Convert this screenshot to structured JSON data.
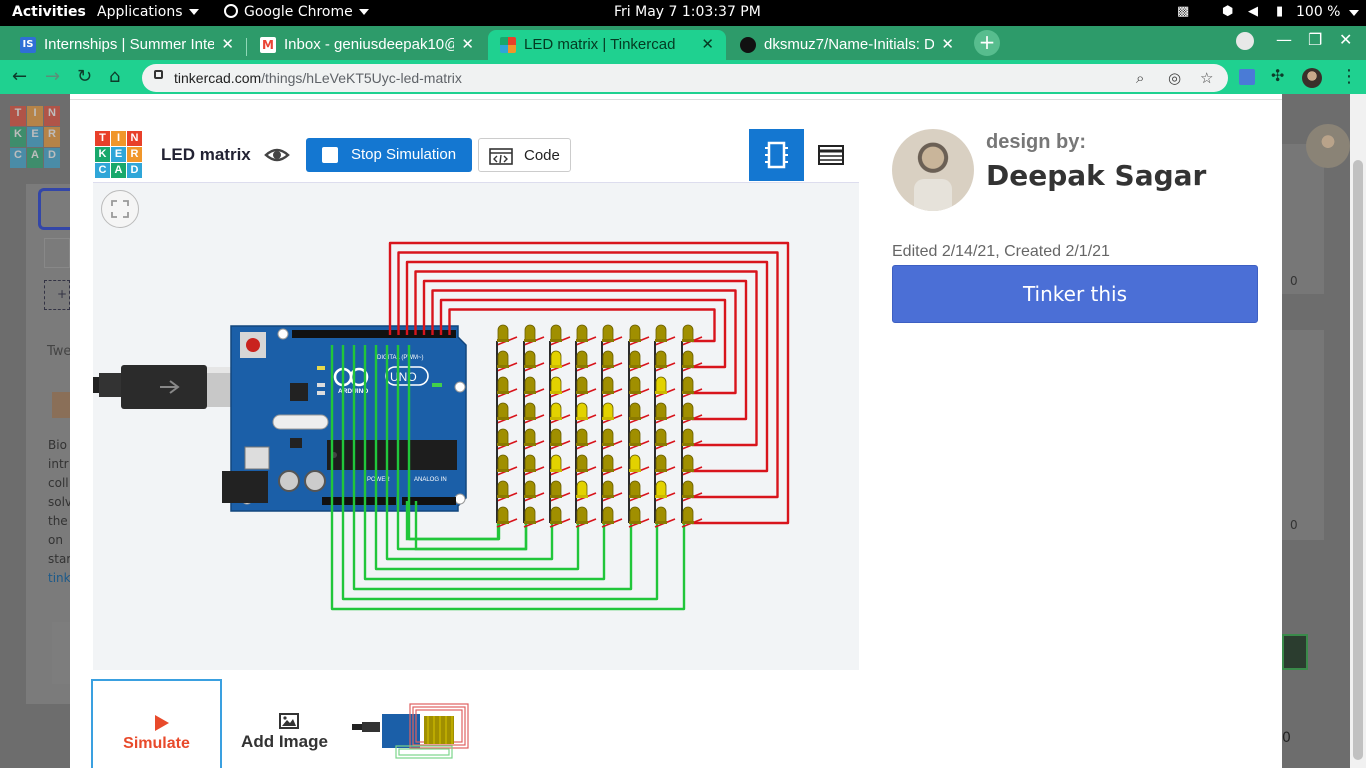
{
  "system_bar": {
    "activities": "Activities",
    "applications": "Applications",
    "active_app": "Google Chrome",
    "clock": "Fri May 7   1:03:37 PM",
    "battery": "100 %"
  },
  "tabs": [
    {
      "title": "Internships | Summer Inte",
      "favicon_color": "#2f6fd6",
      "favicon_text": "IS"
    },
    {
      "title": "Inbox - geniusdeepak10@",
      "favicon_color": "#ea4335",
      "favicon_text": "M"
    },
    {
      "title": "LED matrix | Tinkercad",
      "favicon_color": "#e8402a",
      "favicon_text": ""
    },
    {
      "title": "dksmuz7/Name-Initials: D",
      "favicon_color": "#111111",
      "favicon_text": ""
    }
  ],
  "address_bar": {
    "domain": "tinkercad.com",
    "path": "/things/hLeVeKT5Uyc-led-matrix"
  },
  "design": {
    "title": "LED matrix",
    "stop_simulation": "Stop Simulation",
    "code": "Code",
    "design_by": "design by:",
    "author": "Deepak Sagar",
    "dates": "Edited 2/14/21, Created 2/1/21",
    "tinker_this": "Tinker this"
  },
  "bottom_tiles": {
    "simulate": "Simulate",
    "add_image": "Add Image"
  },
  "board": {
    "brand": "ARDUINO",
    "model": "UNO",
    "digital_label": "DIGITAL (PWM~)",
    "power_label": "POWER",
    "analog_label": "ANALOG IN"
  },
  "background_page": {
    "text_snippets": [
      "Twe",
      "Bio",
      "intr",
      "coll",
      "solv",
      "the",
      "on",
      "star",
      "tink"
    ],
    "counts": [
      "0",
      "0",
      "0"
    ]
  },
  "colors": {
    "tab_strip": "#2d9b6a",
    "toolbar": "#1fd190",
    "primary_blue": "#1477d1",
    "tinker_blue": "#4b6fd6",
    "wire_red": "#d8141c",
    "wire_green": "#21c63a",
    "led_off": "#a08f00",
    "led_on": "#e2d200",
    "arduino_blue": "#1b5fa8",
    "simulate_red": "#e84a2b"
  },
  "led_matrix": {
    "rows": 8,
    "cols": 8,
    "lit": [
      [
        3,
        3
      ],
      [
        3,
        4
      ],
      [
        5,
        5
      ],
      [
        6,
        6
      ],
      [
        3,
        2
      ],
      [
        1,
        2
      ],
      [
        2,
        2
      ],
      [
        5,
        2
      ],
      [
        6,
        3
      ],
      [
        2,
        6
      ]
    ]
  }
}
